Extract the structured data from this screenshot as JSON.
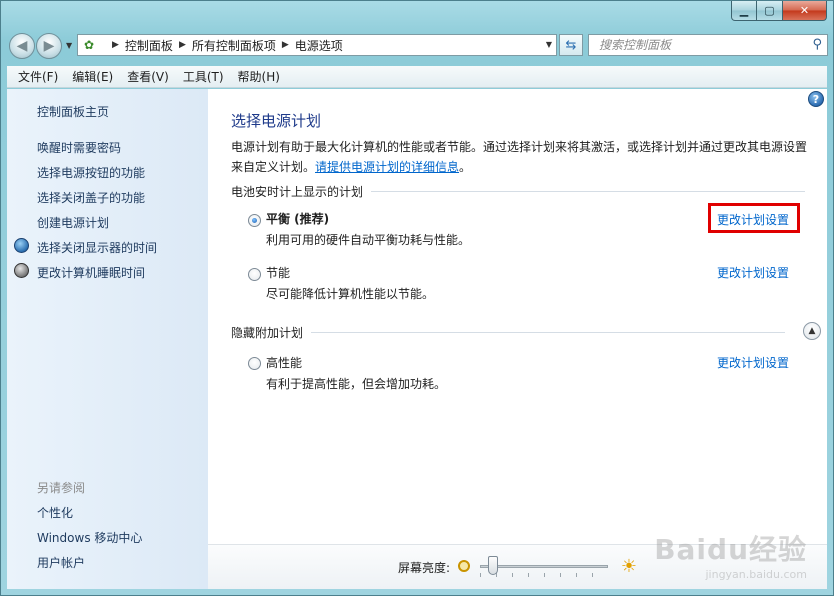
{
  "window": {
    "buttons": {
      "minimize": "▁",
      "maximize": "▢",
      "close": "✕"
    }
  },
  "address_bar": {
    "crumbs": [
      "控制面板",
      "所有控制面板项",
      "电源选项"
    ],
    "icon": "control-panel-icon"
  },
  "search": {
    "placeholder": "搜索控制面板",
    "value": ""
  },
  "menu": [
    "文件(F)",
    "编辑(E)",
    "查看(V)",
    "工具(T)",
    "帮助(H)"
  ],
  "sidebar": {
    "home": "控制面板主页",
    "links": [
      "唤醒时需要密码",
      "选择电源按钮的功能",
      "选择关闭盖子的功能",
      "创建电源计划",
      "选择关闭显示器的时间",
      "更改计算机睡眠时间"
    ],
    "see_also_heading": "另请参阅",
    "see_also": [
      "个性化",
      "Windows 移动中心",
      "用户帐户"
    ]
  },
  "main": {
    "title": "选择电源计划",
    "desc_text": "电源计划有助于最大化计算机的性能或者节能。通过选择计划来将其激活，或选择计划并通过更改其电源设置来自定义计划。",
    "desc_link": "请提供电源计划的详细信息",
    "desc_end": "。",
    "section_battery": "电池安时计上显示的计划",
    "section_hidden": "隐藏附加计划",
    "plans": [
      {
        "name": "平衡 (推荐)",
        "desc": "利用可用的硬件自动平衡功耗与性能。",
        "link": "更改计划设置",
        "selected": true
      },
      {
        "name": "节能",
        "desc": "尽可能降低计算机性能以节能。",
        "link": "更改计划设置",
        "selected": false
      },
      {
        "name": "高性能",
        "desc": "有利于提高性能，但会增加功耗。",
        "link": "更改计划设置",
        "selected": false
      }
    ]
  },
  "brightness": {
    "label": "屏幕亮度:",
    "level_fraction": 0.1
  },
  "watermark": {
    "main": "Baidu经验",
    "sub": "jingyan.baidu.com"
  },
  "colors": {
    "link": "#0066cc",
    "title": "#1e3a8a",
    "highlight": "#e00000"
  }
}
